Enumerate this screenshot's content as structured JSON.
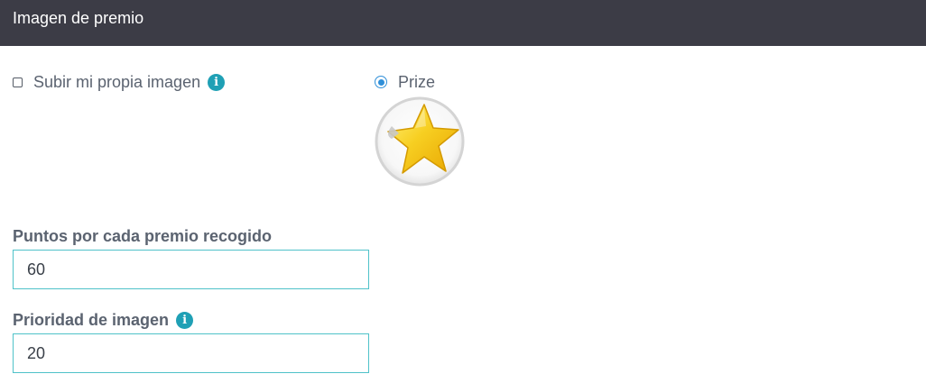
{
  "header": {
    "title": "Imagen de premio"
  },
  "upload_option": {
    "label": "Subir mi propia imagen",
    "checked": false,
    "info_icon": "info-icon"
  },
  "prize_option": {
    "label": "Prize",
    "selected": true,
    "image_icon": "gold-star-icon"
  },
  "points_field": {
    "label": "Puntos por cada premio recogido",
    "value": "60"
  },
  "priority_field": {
    "label": "Prioridad de imagen",
    "value": "20",
    "info_icon": "info-icon"
  },
  "colors": {
    "header_bg": "#3c3c46",
    "accent_teal": "#1fa0b5",
    "input_border": "#4fc2c9",
    "radio_blue": "#2f8fd8",
    "star_gold": "#f5c518"
  }
}
